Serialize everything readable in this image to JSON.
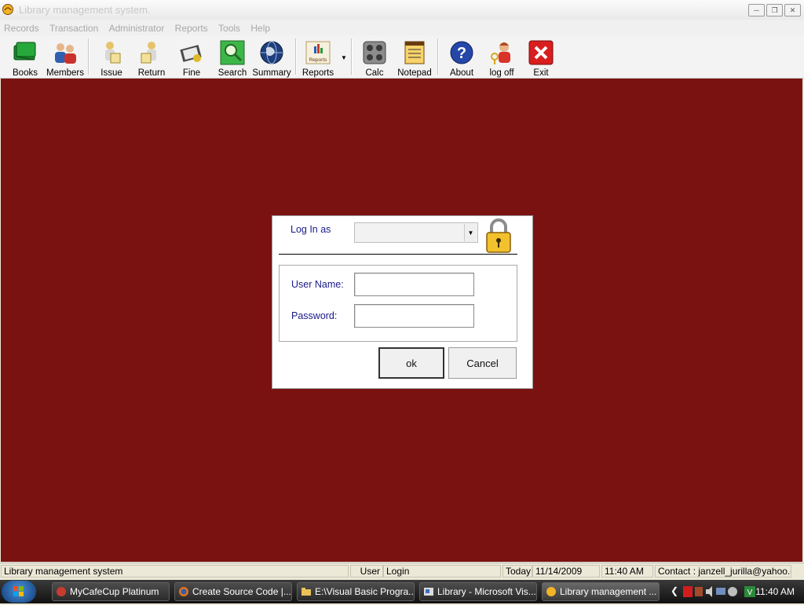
{
  "window": {
    "title": "Library management system."
  },
  "menu": [
    "Records",
    "Transaction",
    "Administrator",
    "Reports",
    "Tools",
    "Help"
  ],
  "toolbar": [
    {
      "label": "Books",
      "icon": "books-icon"
    },
    {
      "label": "Members",
      "icon": "members-icon"
    },
    {
      "label": "Issue",
      "icon": "issue-icon"
    },
    {
      "label": "Return",
      "icon": "return-icon"
    },
    {
      "label": "Fine",
      "icon": "fine-icon"
    },
    {
      "label": "Search",
      "icon": "search-icon"
    },
    {
      "label": "Summary",
      "icon": "globe-icon"
    },
    {
      "label": "Reports",
      "icon": "reports-icon"
    },
    {
      "label": "Calc",
      "icon": "calculator-icon"
    },
    {
      "label": "Notepad",
      "icon": "notepad-icon"
    },
    {
      "label": "About",
      "icon": "help-icon"
    },
    {
      "label": "log off",
      "icon": "log-off-icon"
    },
    {
      "label": "Exit",
      "icon": "exit-icon"
    }
  ],
  "reports_icon_text": "Reports",
  "dialog": {
    "login_as_label": "Log In as",
    "login_as_value": "",
    "username_label": "User Name:",
    "username_value": "",
    "password_label": "Password:",
    "password_value": "",
    "ok_label": "ok",
    "cancel_label": "Cancel"
  },
  "statusbar": {
    "app": "Library management system",
    "user_label": "User",
    "user_value": "Login",
    "today_label": "Today",
    "date": "11/14/2009",
    "time": "11:40 AM",
    "contact": "Contact : janzell_jurilla@yahoo.com"
  },
  "taskbar": {
    "tasks": [
      "MyCafeCup Platinum",
      "Create Source Code |...",
      "E:\\Visual Basic Progra...",
      "Library - Microsoft Vis...",
      "Library management ..."
    ],
    "clock": "11:40 AM"
  },
  "colors": {
    "workspace": "#7a1212",
    "label_text": "#1a1a8c"
  }
}
